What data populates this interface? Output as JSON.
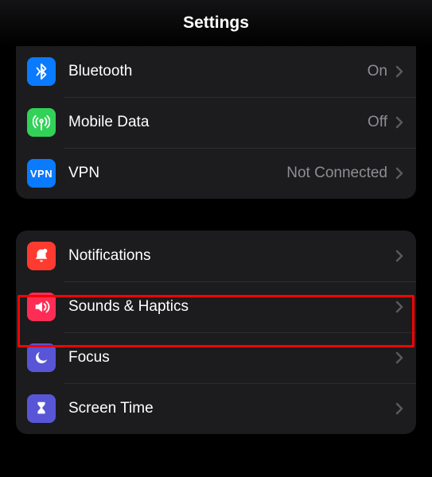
{
  "header": {
    "title": "Settings"
  },
  "group1": {
    "items": [
      {
        "label": "Bluetooth",
        "status": "On",
        "icon": "bluetooth",
        "bg": "bg-blue"
      },
      {
        "label": "Mobile Data",
        "status": "Off",
        "icon": "antenna",
        "bg": "bg-green"
      },
      {
        "label": "VPN",
        "status": "Not Connected",
        "icon": "vpn",
        "bg": "bg-vpn"
      }
    ]
  },
  "group2": {
    "items": [
      {
        "label": "Notifications",
        "icon": "bell",
        "bg": "bg-red"
      },
      {
        "label": "Sounds & Haptics",
        "icon": "speaker",
        "bg": "bg-pink"
      },
      {
        "label": "Focus",
        "icon": "moon",
        "bg": "bg-indigo"
      },
      {
        "label": "Screen Time",
        "icon": "hourglass",
        "bg": "bg-indigo"
      }
    ]
  },
  "highlight": {
    "target": "Sounds & Haptics"
  }
}
